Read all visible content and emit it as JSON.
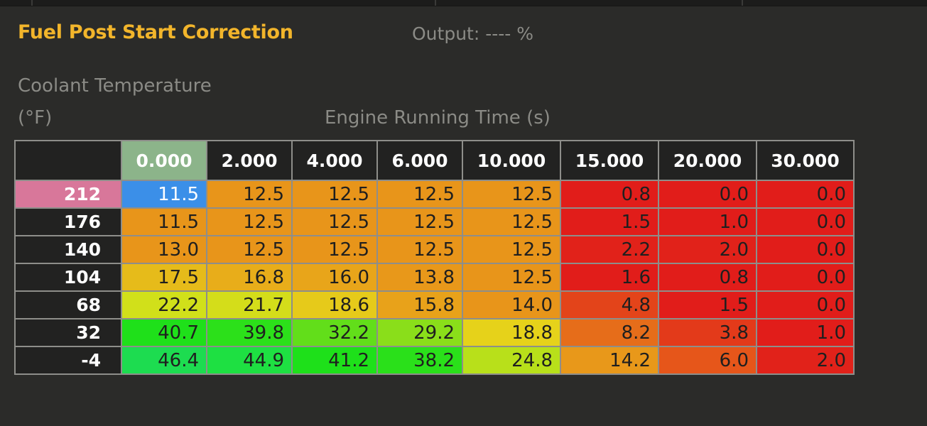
{
  "title": "Fuel Post Start Correction",
  "output": {
    "label": "Output:",
    "value": "----",
    "unit": "%"
  },
  "y_axis": {
    "label": "Coolant Temperature",
    "unit": "(°F)"
  },
  "x_axis": {
    "label": "Engine Running Time (s)"
  },
  "table": {
    "columns": [
      "0.000",
      "2.000",
      "4.000",
      "6.000",
      "10.000",
      "15.000",
      "20.000",
      "30.000"
    ],
    "active_column": 0,
    "active_row": 0,
    "selected_cell": [
      0,
      0
    ],
    "rows": [
      {
        "label": "212",
        "values": [
          "11.5",
          "12.5",
          "12.5",
          "12.5",
          "12.5",
          "0.8",
          "0.0",
          "0.0"
        ],
        "colors": [
          "#3b8fe8",
          "#e8951a",
          "#e8951a",
          "#e8951a",
          "#e8951a",
          "#e11d1a",
          "#e11d1a",
          "#e11d1a"
        ]
      },
      {
        "label": "176",
        "values": [
          "11.5",
          "12.5",
          "12.5",
          "12.5",
          "12.5",
          "1.5",
          "1.0",
          "0.0"
        ],
        "colors": [
          "#e8951a",
          "#e8951a",
          "#e8951a",
          "#e8951a",
          "#e8951a",
          "#e11d1a",
          "#e11d1a",
          "#e11d1a"
        ]
      },
      {
        "label": "140",
        "values": [
          "13.0",
          "12.5",
          "12.5",
          "12.5",
          "12.5",
          "2.2",
          "2.0",
          "0.0"
        ],
        "colors": [
          "#e8951a",
          "#e8951a",
          "#e8951a",
          "#e8951a",
          "#e8951a",
          "#e1221a",
          "#e1221a",
          "#e11d1a"
        ]
      },
      {
        "label": "104",
        "values": [
          "17.5",
          "16.8",
          "16.0",
          "13.8",
          "12.5",
          "1.6",
          "0.8",
          "0.0"
        ],
        "colors": [
          "#e6bb1a",
          "#e8ad1a",
          "#e8a51a",
          "#e8981a",
          "#e8951a",
          "#e11d1a",
          "#e11d1a",
          "#e11d1a"
        ]
      },
      {
        "label": "68",
        "values": [
          "22.2",
          "21.7",
          "18.6",
          "15.8",
          "14.0",
          "4.8",
          "1.5",
          "0.0"
        ],
        "colors": [
          "#d1e01a",
          "#d4dd1a",
          "#e6ca1a",
          "#e8a21a",
          "#e8951a",
          "#e3441a",
          "#e11d1a",
          "#e11d1a"
        ]
      },
      {
        "label": "32",
        "values": [
          "40.7",
          "39.8",
          "32.2",
          "29.2",
          "18.8",
          "8.2",
          "3.8",
          "1.0"
        ],
        "colors": [
          "#1fe01a",
          "#2ce01a",
          "#62de1a",
          "#8ade1a",
          "#e6d21a",
          "#e66d1a",
          "#e33a1a",
          "#e11d1a"
        ]
      },
      {
        "label": "-4",
        "values": [
          "46.4",
          "44.9",
          "41.2",
          "38.2",
          "24.8",
          "14.2",
          "6.0",
          "2.0"
        ],
        "colors": [
          "#1ddc50",
          "#1ee042",
          "#1ee01a",
          "#2ae01a",
          "#b8e01a",
          "#e8981a",
          "#e6561a",
          "#e1221a"
        ]
      }
    ]
  }
}
